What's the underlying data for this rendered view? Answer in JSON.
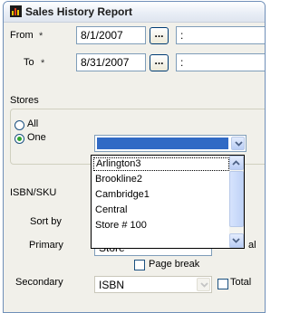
{
  "window": {
    "title": "Sales History Report",
    "icon": "report-icon"
  },
  "from": {
    "label": "From",
    "required_mark": "*",
    "date": "8/1/2007",
    "browse_label": "...",
    "time": ":"
  },
  "to": {
    "label": "To",
    "required_mark": "*",
    "date": "8/31/2007",
    "browse_label": "...",
    "time": ":"
  },
  "stores": {
    "label": "Stores",
    "options": [
      {
        "label": "All",
        "checked": false
      },
      {
        "label": "One",
        "checked": true
      }
    ],
    "combo_value": ""
  },
  "dropdown": {
    "items": [
      "Arlington3",
      "Brookline2",
      "Cambridge1",
      "Central",
      "Store # 100"
    ],
    "highlighted_index": 0
  },
  "isbn": {
    "label": "ISBN/SKU"
  },
  "sort": {
    "label": "Sort by",
    "primary_label": "Primary",
    "primary_value": "Store",
    "page_break_label": "Page break",
    "secondary_label": "Secondary",
    "secondary_value": "ISBN",
    "total_label": "Total",
    "right_clip": "al"
  },
  "colors": {
    "selection": "#316ac5",
    "radio_dot": "#2fa52f",
    "panel_bg": "#f1f0ea"
  }
}
